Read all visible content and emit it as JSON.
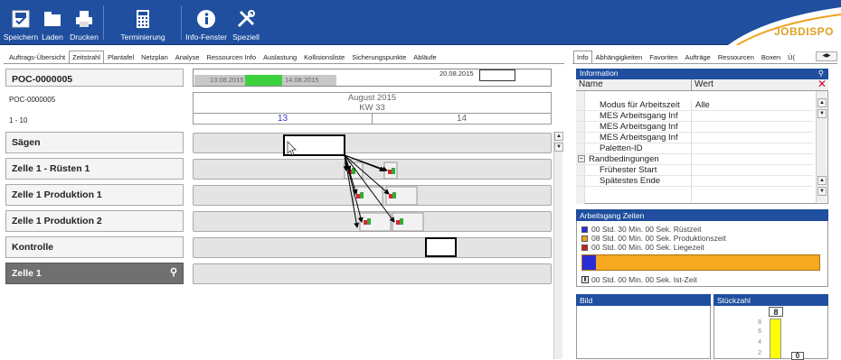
{
  "toolbar": {
    "buttons": [
      {
        "label": "Speichern",
        "icon": "save-icon"
      },
      {
        "label": "Laden",
        "icon": "folder-icon"
      },
      {
        "label": "Drucken",
        "icon": "printer-icon"
      },
      {
        "label": "Terminierung",
        "icon": "calculator-icon"
      },
      {
        "label": "Info-Fenster",
        "icon": "info-icon"
      },
      {
        "label": "Speziell",
        "icon": "tools-icon"
      }
    ],
    "logo": "JOBDISPO"
  },
  "main_tabs": [
    "Auftrags-Übersicht",
    "Zeitstrahl",
    "Plantafel",
    "Netzplan",
    "Analyse",
    "Ressourcen Info",
    "Auslastung",
    "Kollisionsliste",
    "Sicherungspunkte",
    "Abläufe"
  ],
  "active_main_tab": "Zeitstrahl",
  "left": {
    "order_title": "POC-0000005",
    "order_sub": "POC-0000005",
    "range": "1 - 10",
    "resources": [
      "Sägen",
      "Zelle 1 - Rüsten 1",
      "Zelle 1 Produktion 1",
      "Zelle 1 Produktion 2",
      "Kontrolle"
    ],
    "group": "Zelle 1"
  },
  "timeline": {
    "date_from": "13.08.2015",
    "date_to": "14.08.2015",
    "current_date": "20.08.2015",
    "month": "August 2015",
    "week": "KW 33",
    "days": [
      "13",
      "14"
    ]
  },
  "right_tabs": [
    "Info",
    "Abhängigkeiten",
    "Favoriten",
    "Aufträge",
    "Ressourcen",
    "Boxen",
    "Ü("
  ],
  "active_right_tab": "Info",
  "info": {
    "title": "Information",
    "col_name": "Name",
    "col_value": "Wert",
    "rows": [
      {
        "name": "Modus für Arbeitszeit",
        "value": "Alle"
      },
      {
        "name": "MES Arbeitsgang Inf",
        "value": ""
      },
      {
        "name": "MES Arbeitsgang Inf",
        "value": ""
      },
      {
        "name": "MES Arbeitsgang Inf",
        "value": ""
      },
      {
        "name": "Paletten-ID",
        "value": ""
      }
    ],
    "section": "Randbedingungen",
    "section_rows": [
      {
        "name": "Frühester Start",
        "value": ""
      },
      {
        "name": "Spätestes Ende",
        "value": ""
      }
    ]
  },
  "times": {
    "title": "Arbeitsgang Zeiten",
    "entries": [
      {
        "time": "00 Std. 30 Min. 00 Sek.",
        "label": "Rüstzeit",
        "color": "#2b2bd6"
      },
      {
        "time": "08 Std. 00 Min. 00 Sek.",
        "label": "Produktionszeit",
        "color": "#f0a020"
      },
      {
        "time": "00 Std. 00 Min. 00 Sek.",
        "label": "Liegezeit",
        "color": "#cc2020"
      }
    ],
    "ist": {
      "time": "00 Std. 00 Min. 00 Sek.",
      "label": "Ist-Zeit"
    }
  },
  "bild": {
    "title": "Bild"
  },
  "stueckzahl": {
    "title": "Stückzahl",
    "value": "8",
    "second_value": "0",
    "ticks": [
      "8",
      "6",
      "4",
      "2"
    ]
  },
  "colors": {
    "brand_blue": "#1f4f9e",
    "setup": "#2b2bd6",
    "production": "#f0a020",
    "idle": "#cc2020"
  }
}
